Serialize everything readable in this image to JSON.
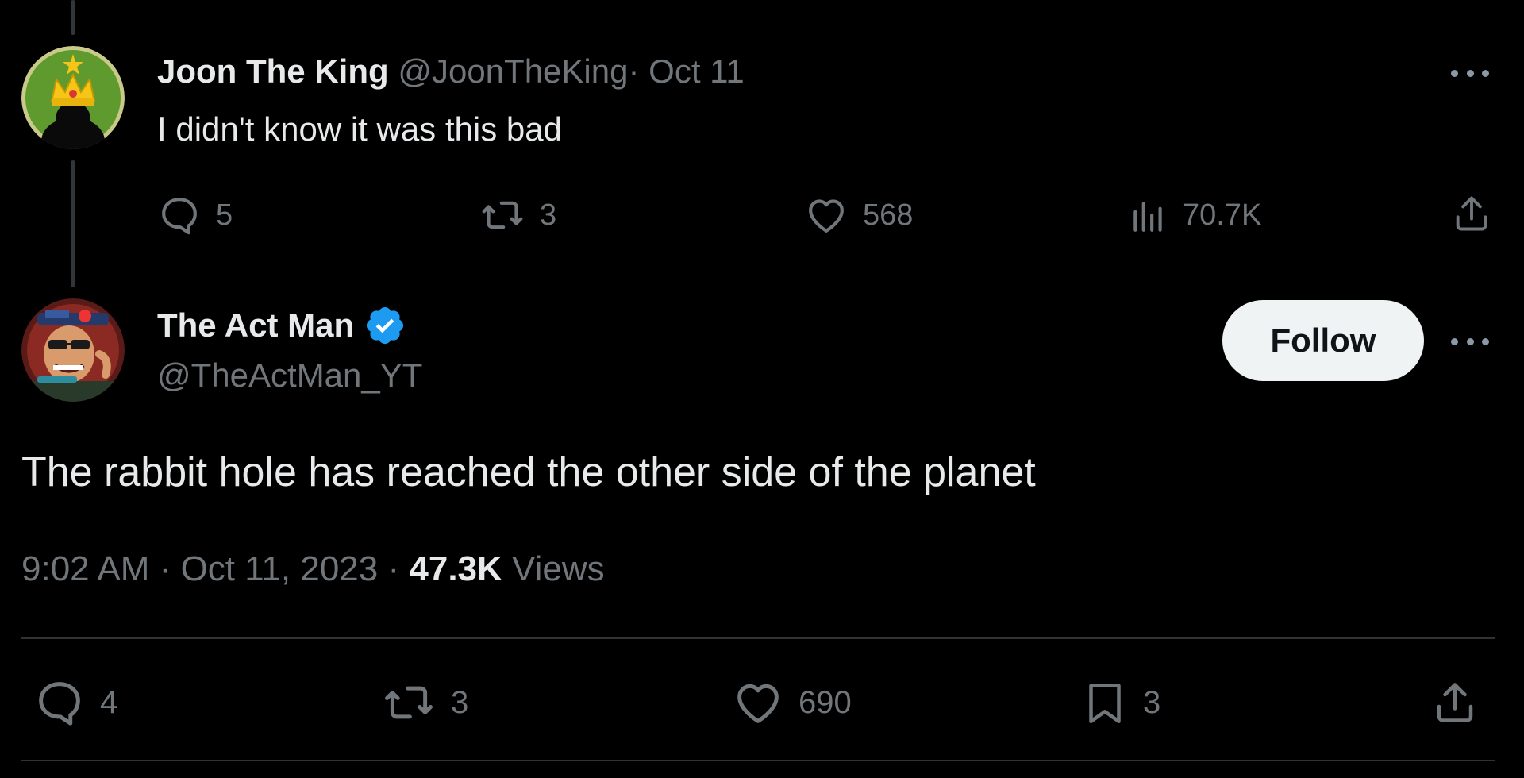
{
  "reply": {
    "name": "Joon The King",
    "handle": "@JoonTheKing",
    "separator": "·",
    "date": "Oct 11",
    "text": "I didn't know it was this bad",
    "replies": "5",
    "reposts": "3",
    "likes": "568",
    "views": "70.7K"
  },
  "main": {
    "name": "The Act Man",
    "handle": "@TheActMan_YT",
    "follow_label": "Follow",
    "text": "The rabbit hole has reached the other side of the planet",
    "time": "9:02 AM",
    "sep1": "·",
    "date": "Oct 11, 2023",
    "sep2": "·",
    "views_count": "47.3K",
    "views_label": "Views",
    "replies": "4",
    "reposts": "3",
    "likes": "690",
    "bookmarks": "3"
  },
  "colors": {
    "background": "#000000",
    "text": "#e7e9ea",
    "muted": "#71767b",
    "verified": "#1d9bf0",
    "follow_bg": "#eff3f4",
    "divider": "#2f3336"
  },
  "icons": [
    "reply-icon",
    "repost-icon",
    "like-icon",
    "views-icon",
    "share-icon",
    "bookmark-icon",
    "more-icon",
    "verified-badge-icon"
  ]
}
